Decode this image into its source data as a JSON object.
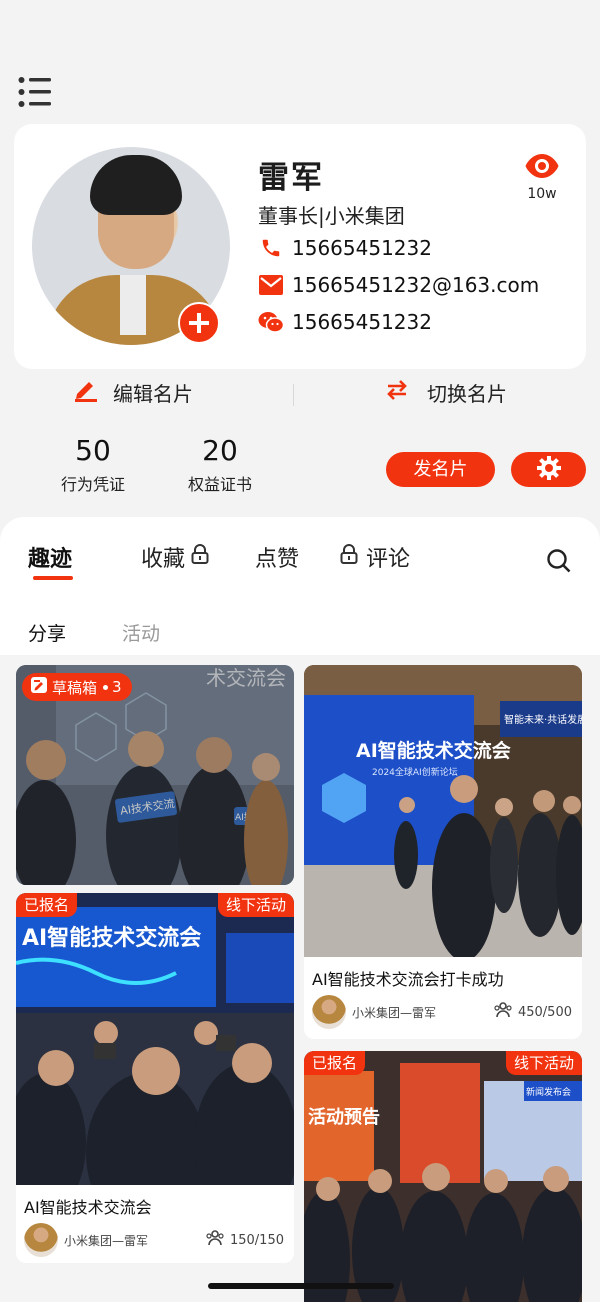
{
  "profile": {
    "name": "雷军",
    "title": "董事长|小米集团",
    "phone": "15665451232",
    "email": "15665451232@163.com",
    "wechat": "15665451232",
    "views": "10w"
  },
  "actions": {
    "edit": "编辑名片",
    "switch": "切换名片"
  },
  "stats": [
    {
      "num": "50",
      "label": "行为凭证"
    },
    {
      "num": "20",
      "label": "权益证书"
    }
  ],
  "buttons": {
    "send": "发名片"
  },
  "tabs": [
    "趣迹",
    "收藏",
    "点赞",
    "评论"
  ],
  "subtabs": [
    "分享",
    "活动"
  ],
  "cards": [
    {
      "draft_label": "草稿箱",
      "draft_count": "3",
      "sign_text": "AI技术交流",
      "sign_text_2": "AI技术交流",
      "banner_text": "术交流会"
    },
    {
      "title": "AI智能技术交流会打卡成功",
      "author": "小米集团—雷军",
      "count": "450/500",
      "banner_text": "AI智能技术交流会",
      "banner_sub": "2024全球AI创新论坛",
      "screen_text": "智能未来·共话发展"
    },
    {
      "tag_left": "已报名",
      "tag_right": "线下活动",
      "title": "AI智能技术交流会",
      "author": "小米集团—雷军",
      "count": "150/150",
      "banner_text": "AI智能技术交流会"
    },
    {
      "tag_left": "已报名",
      "tag_right": "线下活动",
      "banner_text": "活动预告",
      "sign_text": "新闻发布会"
    }
  ],
  "colors": {
    "accent": "#f2330f"
  }
}
